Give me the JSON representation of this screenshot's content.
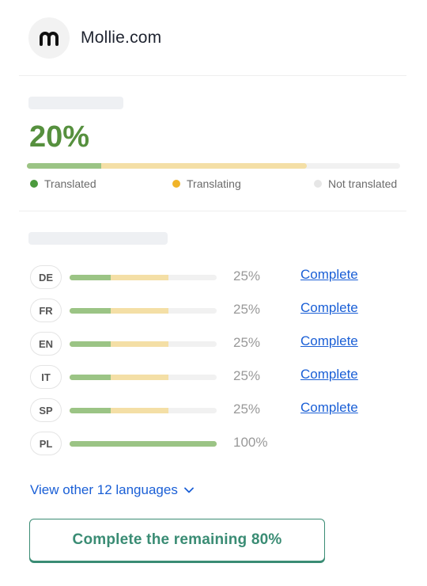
{
  "header": {
    "site_name": "Mollie.com",
    "logo_letter": "m"
  },
  "summary": {
    "percent_label": "20%",
    "translated_fraction": 0.2,
    "translating_fraction": 0.55,
    "legend": {
      "translated": "Translated",
      "translating": "Translating",
      "not_translated": "Not translated"
    }
  },
  "colors": {
    "translated": "#9bc485",
    "translating": "#f4dfa6",
    "not_translated": "#f1f1f1",
    "translated_dot": "#4b9a3d",
    "translating_dot": "#f0b429",
    "not_translated_dot": "#e6e6e6",
    "big_percent": "#56903e",
    "link": "#1a5fd6",
    "cta": "#3a8c74"
  },
  "languages": [
    {
      "code": "DE",
      "percent": "25%",
      "translated": 0.28,
      "translating": 0.39,
      "action": "Complete"
    },
    {
      "code": "FR",
      "percent": "25%",
      "translated": 0.28,
      "translating": 0.39,
      "action": "Complete"
    },
    {
      "code": "EN",
      "percent": "25%",
      "translated": 0.28,
      "translating": 0.39,
      "action": "Complete"
    },
    {
      "code": "IT",
      "percent": "25%",
      "translated": 0.28,
      "translating": 0.39,
      "action": "Complete"
    },
    {
      "code": "SP",
      "percent": "25%",
      "translated": 0.28,
      "translating": 0.39,
      "action": "Complete"
    },
    {
      "code": "PL",
      "percent": "100%",
      "translated": 1.0,
      "translating": 0.0,
      "action": ""
    }
  ],
  "view_other": {
    "label": "View other 12 languages"
  },
  "cta": {
    "label": "Complete the remaining 80%"
  }
}
